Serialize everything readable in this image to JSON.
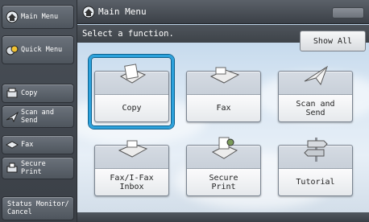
{
  "sidebar": {
    "main_menu": "Main Menu",
    "quick_menu": "Quick Menu",
    "items": [
      {
        "label": "Copy",
        "icon": "copy-icon"
      },
      {
        "label": "Scan and\nSend",
        "icon": "scan-send-icon"
      },
      {
        "label": "Fax",
        "icon": "fax-icon"
      },
      {
        "label": "Secure\nPrint",
        "icon": "secure-print-icon"
      }
    ],
    "status_monitor": "Status Monitor/\nCancel"
  },
  "header": {
    "title": "Main Menu",
    "instruction": "Select a function.",
    "show_all": "Show All"
  },
  "functions": [
    {
      "label": "Copy",
      "icon": "copy-icon",
      "selected": true
    },
    {
      "label": "Fax",
      "icon": "fax-icon",
      "selected": false
    },
    {
      "label": "Scan and\nSend",
      "icon": "scan-send-icon",
      "selected": false
    },
    {
      "label": "Fax/I-Fax\nInbox",
      "icon": "inbox-icon",
      "selected": false
    },
    {
      "label": "Secure\nPrint",
      "icon": "secure-print-icon",
      "selected": false
    },
    {
      "label": "Tutorial",
      "icon": "tutorial-icon",
      "selected": false
    }
  ],
  "colors": {
    "selection": "#2ca2dc",
    "sidebar": "#3a3f46"
  }
}
